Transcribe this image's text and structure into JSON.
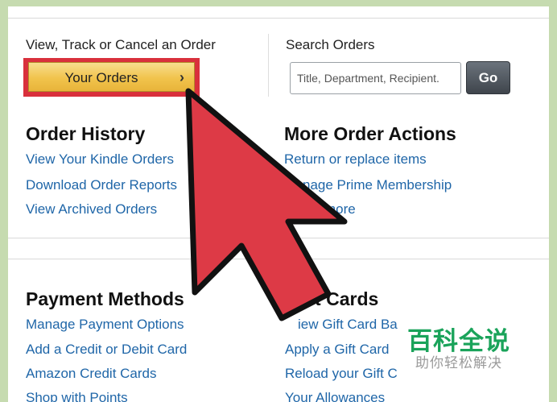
{
  "top": {
    "view_track_label": "View, Track or Cancel an Order",
    "your_orders_button": "Your Orders",
    "search_label": "Search Orders",
    "search_placeholder": "Title, Department, Recipient.",
    "go_button": "Go"
  },
  "order_history": {
    "heading": "Order History",
    "links": [
      "View Your Kindle Orders",
      "Download Order Reports",
      "View Archived Orders"
    ]
  },
  "more_actions": {
    "heading": "More Order Actions",
    "links": [
      "Return or replace items",
      "nage Prime Membership",
      "more"
    ]
  },
  "payment_methods": {
    "heading": "Payment Methods",
    "links": [
      "Manage Payment Options",
      "Add a Credit or Debit Card",
      "Amazon Credit Cards",
      "Shop with Points"
    ]
  },
  "gift_cards": {
    "heading": "ift Cards",
    "links": [
      "iew Gift Card Ba",
      "Apply a Gift Card",
      "Reload your Gift C",
      "Your Allowances"
    ]
  },
  "watermark": {
    "title": "百科全说",
    "subtitle": "助你轻松解决"
  },
  "colors": {
    "link": "#1f66a8",
    "highlight_outline": "#d9303c",
    "arrow_fill": "#dd3a46",
    "button_gold": "#f1c34c",
    "watermark_green": "#1aa35a",
    "border_green": "#c6dbb0"
  },
  "icons": [
    "chevron-right-icon",
    "pointer-arrow-icon"
  ]
}
